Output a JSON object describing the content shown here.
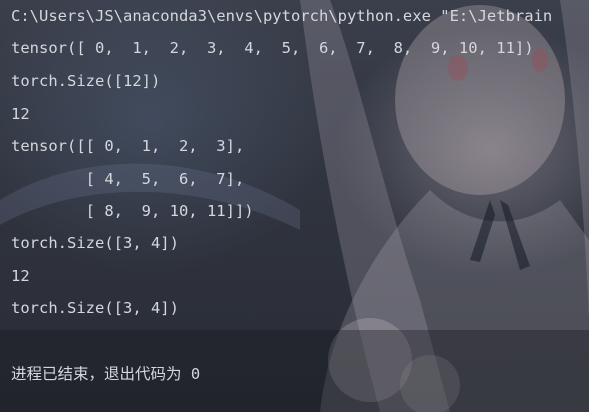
{
  "console": {
    "lines": [
      "C:\\Users\\JS\\anaconda3\\envs\\pytorch\\python.exe \"E:\\Jetbrain",
      "tensor([ 0,  1,  2,  3,  4,  5,  6,  7,  8,  9, 10, 11])",
      "torch.Size([12])",
      "12",
      "tensor([[ 0,  1,  2,  3],",
      "        [ 4,  5,  6,  7],",
      "        [ 8,  9, 10, 11]])",
      "torch.Size([3, 4])",
      "12",
      "torch.Size([3, 4])",
      "进程已结束，退出代码为 0"
    ]
  },
  "colors": {
    "text": "#d4d7dc",
    "background": "#2b2f39"
  }
}
